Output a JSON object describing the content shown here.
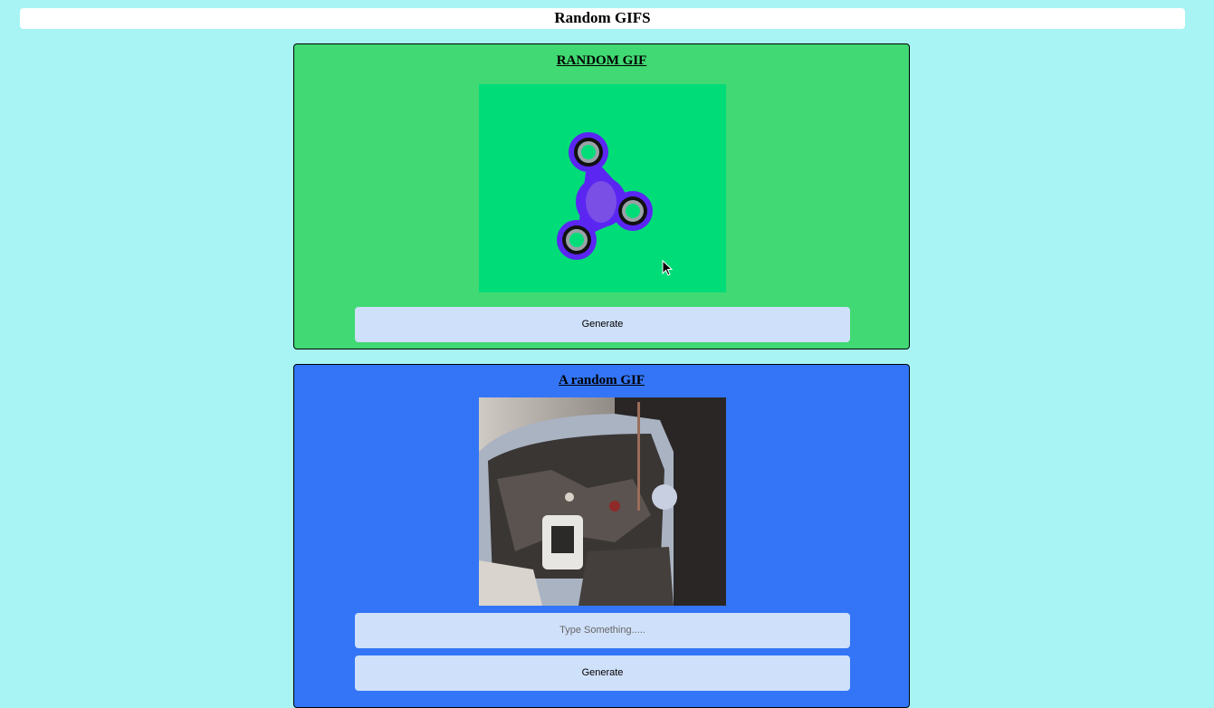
{
  "header": {
    "title": "Random GIFS"
  },
  "cards": [
    {
      "title": "RANDOM GIF",
      "image": "fidget-spinner-gif",
      "button_label": "Generate",
      "background": "#41d973"
    },
    {
      "title": "A random GIF",
      "image": "car-engine-gif",
      "input_placeholder": "Type Something.....",
      "input_value": "",
      "button_label": "Generate",
      "background": "#3375f6"
    }
  ],
  "colors": {
    "page_background": "#a8f4f5",
    "button_background": "#cfe0fa"
  }
}
